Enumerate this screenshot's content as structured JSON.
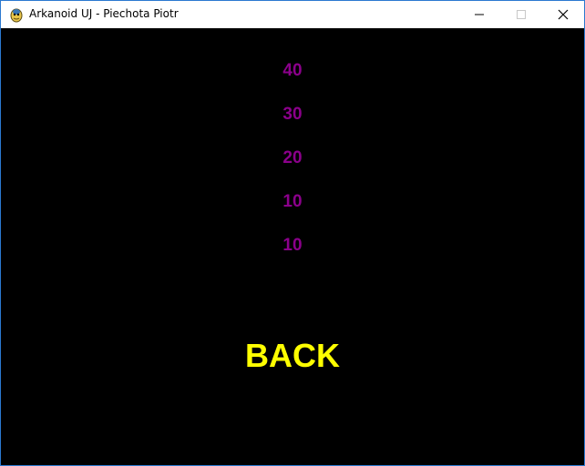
{
  "window": {
    "title": "Arkanoid UJ - Piechota Piotr"
  },
  "scores": [
    "40",
    "30",
    "20",
    "10",
    "10"
  ],
  "back_label": "BACK",
  "colors": {
    "background": "#000000",
    "score_text": "#8b008b",
    "back_text": "#ffff00"
  }
}
